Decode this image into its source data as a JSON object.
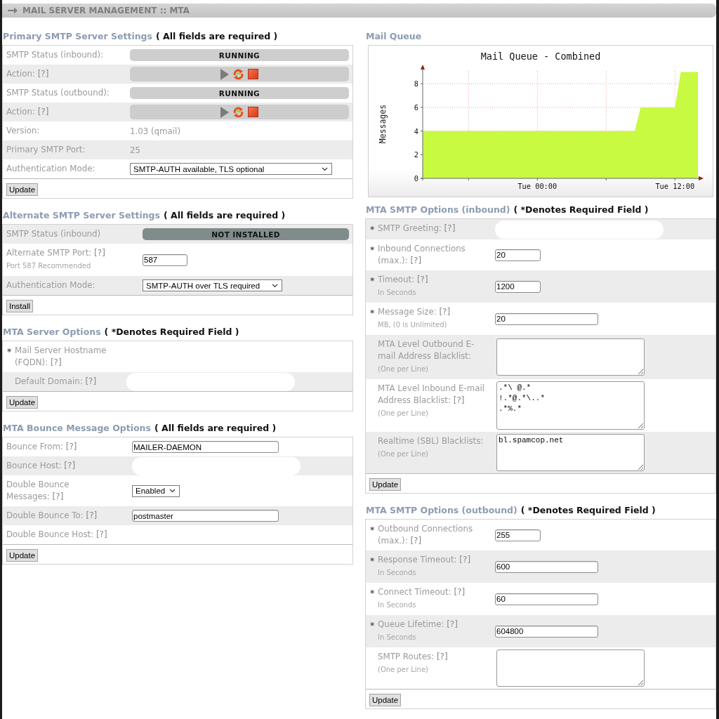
{
  "header": {
    "title": "MAIL SERVER MANAGEMENT :: MTA"
  },
  "columns": [
    {
      "sections": [
        {
          "kind": "form",
          "title": "Primary SMTP Server Settings",
          "note": "( All fields are required )",
          "rows": [
            {
              "kind": "status",
              "label": "SMTP Status (inbound):",
              "value": "RUNNING",
              "installed": true
            },
            {
              "kind": "actions",
              "label": "Action:",
              "help": "[?]",
              "actions": [
                {
                  "kind": "start",
                  "disabled": true
                },
                {
                  "kind": "restart",
                  "disabled": false
                },
                {
                  "kind": "stop",
                  "disabled": false
                }
              ]
            },
            {
              "kind": "status",
              "label": "SMTP Status (outbound):",
              "value": "RUNNING",
              "installed": true
            },
            {
              "kind": "actions",
              "label": "Action:",
              "help": "[?]",
              "actions": [
                {
                  "kind": "start",
                  "disabled": true
                },
                {
                  "kind": "restart",
                  "disabled": false
                },
                {
                  "kind": "stop",
                  "disabled": false
                }
              ]
            },
            {
              "kind": "text",
              "label": "Version:",
              "value": "1.03 (qmail)"
            },
            {
              "kind": "text",
              "label": "Primary SMTP Port:",
              "value": "25"
            },
            {
              "kind": "select",
              "label": "Authentication Mode:",
              "value": "SMTP-AUTH available, TLS optional"
            }
          ],
          "button": "Update"
        },
        {
          "kind": "form",
          "title": "Alternate SMTP Server Settings",
          "note": "( All fields are required )",
          "rows": [
            {
              "kind": "status",
              "label": "SMTP Status (inbound)",
              "value": "NOT INSTALLED",
              "installed": false
            },
            {
              "kind": "input",
              "label": "Alternate SMTP Port:",
              "help": "[?]",
              "hint": "Port 587 Recommended",
              "value": "587"
            },
            {
              "kind": "select",
              "label": "Authentication Mode:",
              "value": "SMTP-AUTH over TLS required"
            }
          ],
          "button": "Install"
        },
        {
          "kind": "form",
          "title": "MTA Server Options",
          "note": "( *Denotes Required Field )",
          "rows": [
            {
              "kind": "text",
              "marker": "*",
              "label": "Mail Server Hostname (FQDN):",
              "help": "[?]"
            },
            {
              "kind": "redacted",
              "label": "Default Domain:",
              "help": "[?]"
            }
          ],
          "button": "Update"
        },
        {
          "kind": "form",
          "title": "MTA Bounce Message Options",
          "note": "( All fields are required )",
          "rows": [
            {
              "kind": "input",
              "label": "Bounce From:",
              "help": "[?]",
              "value": "MAILER-DAEMON"
            },
            {
              "kind": "redacted",
              "label": "Bounce Host:",
              "help": "[?]"
            },
            {
              "kind": "select",
              "label": "Double Bounce Messages:",
              "help": "[?]",
              "value": "Enabled"
            },
            {
              "kind": "input",
              "label": "Double Bounce To:",
              "help": "[?]",
              "value": "postmaster"
            },
            {
              "kind": "text",
              "label": "Double Bounce Host:",
              "help": "[?]"
            }
          ],
          "button": "Update"
        }
      ]
    },
    {
      "sections": [
        {
          "kind": "chart",
          "title": "Mail Queue",
          "chart_data": {
            "type": "area",
            "title": "Mail Queue - Combined",
            "ylabel": "Messages",
            "grid": true,
            "categories": [
              null,
              null,
              null,
              null,
              null,
              null,
              null,
              null,
              null,
              null,
              null,
              null,
              null,
              null,
              null,
              null,
              null,
              null,
              null,
              null,
              "Tue 00:00",
              null,
              null,
              null,
              null,
              null,
              null,
              null,
              null,
              null,
              null,
              null,
              null,
              null,
              null,
              null,
              null,
              null,
              null,
              null,
              null,
              null,
              null,
              null,
              "Tue 12:00",
              null,
              null,
              null,
              null
            ],
            "series": [
              {
                "color": "#c8fa41",
                "values": [
                  4,
                  4,
                  4,
                  4,
                  4,
                  4,
                  4,
                  4,
                  4,
                  4,
                  4,
                  4,
                  4,
                  4,
                  4,
                  4,
                  4,
                  4,
                  4,
                  4,
                  4,
                  4,
                  4,
                  4,
                  4,
                  4,
                  4,
                  4,
                  4,
                  4,
                  4,
                  4,
                  4,
                  4,
                  4,
                  4,
                  4,
                  4,
                  6,
                  6,
                  6,
                  6,
                  6,
                  6,
                  6,
                  9,
                  9,
                  9,
                  9
                ]
              }
            ],
            "ylim": [
              0,
              9.2
            ],
            "yticks": [
              0,
              2,
              4,
              6,
              8
            ]
          }
        },
        {
          "kind": "form",
          "title": "MTA SMTP Options (inbound)",
          "note": "( *Denotes Required Field )",
          "rows": [
            {
              "kind": "redacted",
              "marker": "*",
              "label": "SMTP Greeting:",
              "help": "[?]"
            },
            {
              "kind": "input",
              "marker": "*",
              "label": "Inbound Connections (max.):",
              "help": "[?]",
              "value": "20"
            },
            {
              "kind": "input",
              "marker": "*",
              "label": "Timeout:",
              "help": "[?]",
              "hint": "In Seconds",
              "value": "1200"
            },
            {
              "kind": "input",
              "marker": "*",
              "label": "Message Size:",
              "help": "[?]",
              "hint": "MB, (0 is Unlimited)",
              "value": "20"
            },
            {
              "kind": "textarea",
              "label": "MTA Level Outbound E-mail Address Blacklist:",
              "hint": "(One per Line)"
            },
            {
              "kind": "textarea",
              "label": "MTA Level Inbound E-mail Address Blacklist:",
              "help": "[?]",
              "hint": "(One per Line)",
              "value": ".*\\ @.*\n!.*@.*\\..*\n.*%.*"
            },
            {
              "kind": "textarea",
              "label": "Realtime (SBL) Blacklists:",
              "hint": "(One per Line)",
              "value": "bl.spamcop.net"
            }
          ],
          "button": "Update"
        },
        {
          "kind": "form",
          "title": "MTA SMTP Options (outbound)",
          "note": "( *Denotes Required Field )",
          "rows": [
            {
              "kind": "input",
              "marker": "*",
              "label": "Outbound Connections (max.):",
              "help": "[?]",
              "value": "255"
            },
            {
              "kind": "input",
              "marker": "*",
              "label": "Response Timeout:",
              "help": "[?]",
              "hint": "In Seconds",
              "value": "600"
            },
            {
              "kind": "input",
              "marker": "*",
              "label": "Connect Timeout:",
              "help": "[?]",
              "hint": "In Seconds",
              "value": "60"
            },
            {
              "kind": "input",
              "marker": "*",
              "label": "Queue Lifetime:",
              "help": "[?]",
              "hint": "In Seconds",
              "value": "604800"
            },
            {
              "kind": "textarea",
              "label": "SMTP Routes:",
              "help": "[?]",
              "hint": "(One per Line)"
            }
          ],
          "button": "Update"
        }
      ]
    }
  ]
}
